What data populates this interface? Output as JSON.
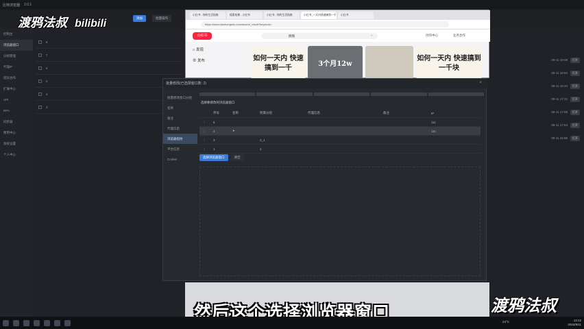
{
  "app": {
    "title": "比特浏览器",
    "version": "2.0.1"
  },
  "sidebar": {
    "items": [
      "控制台",
      "浏览器窗口",
      "分组管理",
      "代理IP",
      "团队协作",
      "扩展中心",
      "API",
      "RPA",
      "同步器",
      "费用中心",
      "系统设置",
      "个人中心"
    ]
  },
  "toolbar": {
    "new_button": "添加",
    "batch_button": "批量操作"
  },
  "list": {
    "rows": [
      "8",
      "7",
      "6",
      "5",
      "4",
      "3"
    ]
  },
  "right_list": {
    "action_label": "打开",
    "rows": [
      "09-11 19:08",
      "09-11 18:54",
      "09-11 18:34",
      "09-11 17:21",
      "09-11 17:08",
      "09-11 17:04",
      "09-11 16:58"
    ]
  },
  "browser": {
    "tabs": [
      "小红书 - 你的生活指南",
      "搜索结果 - 小红书",
      "小红书 - 你的生活指南",
      "小红书_一天内快速搞到一千块",
      "小红书"
    ],
    "url": "https://www.xiaohongshu.com/search_result?keyword=",
    "logo": "小红书",
    "search_value": "搞钱",
    "header_links": [
      "创作中心",
      "业务合作"
    ],
    "nav": [
      "发现",
      "发布"
    ],
    "card1_text": "如何一天内 快速搞到一千",
    "card2_text": "3个月12w",
    "card3_text": "如何一天内 快速搞到一千块"
  },
  "dialog": {
    "title": "批量修改(已选择窗口数: 2)",
    "side_items": [
      "批量修改窗口分组",
      "名称",
      "备注",
      "代理信息",
      "浏览器指纹",
      "平台信息",
      "Cookie"
    ],
    "heading": "选择要修改的浏览器窗口",
    "columns": [
      "序号",
      "名称",
      "所属分组",
      "代理信息",
      "备注",
      "IP"
    ],
    "rows": [
      {
        "index": "6",
        "ip": "111"
      },
      {
        "index": "4",
        "ip": "111"
      },
      {
        "index": "3",
        "name": "2_1"
      },
      {
        "index": "1",
        "name": "2"
      }
    ],
    "select_button": "选择浏览器窗口",
    "clear_button": "清空"
  },
  "subtitle": "然后这个选择浏览器窗口",
  "watermark": {
    "top": "渡鸦法叔",
    "brand": "bilibili",
    "bottom": "渡鸦法叔"
  },
  "taskbar": {
    "temperature": "24°C",
    "time": "13:12",
    "date": "2024/9/11"
  },
  "colors": {
    "accent": "#3a7bd5",
    "xhs_red": "#ff2442"
  }
}
